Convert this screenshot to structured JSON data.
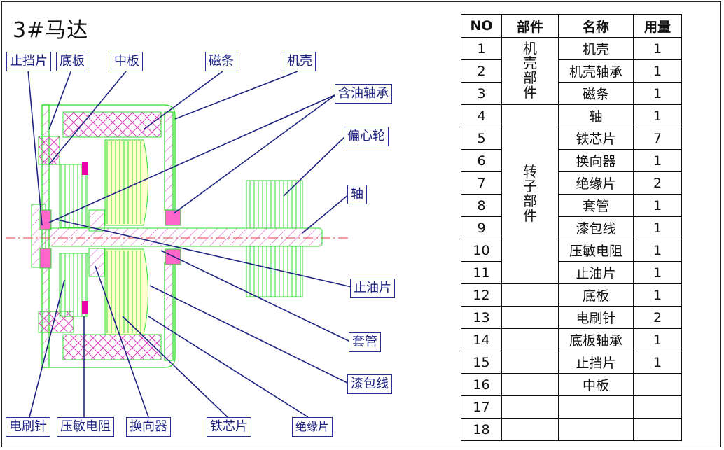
{
  "title": "3#马达",
  "callouts": {
    "stop_plate": "止挡片",
    "base_plate": "底板",
    "mid_plate": "中板",
    "magnet": "磁条",
    "housing": "机壳",
    "oil_bearing": "含油轴承",
    "eccentric": "偏心轮",
    "shaft": "轴",
    "oil_stop": "止油片",
    "sleeve": "套管",
    "enamel_wire": "漆包线",
    "brush": "电刷针",
    "varistor": "压敏电阻",
    "commutator": "换向器",
    "core": "铁芯片",
    "insulation": "绝缘片"
  },
  "table": {
    "headers": [
      "NO",
      "部件",
      "名称",
      "用量"
    ],
    "groups": {
      "housing_group": "机壳部件",
      "rotor_group": "转子部件"
    },
    "rows": [
      {
        "no": "1",
        "name": "机壳",
        "qty": "1"
      },
      {
        "no": "2",
        "name": "机壳轴承",
        "qty": "1"
      },
      {
        "no": "3",
        "name": "磁条",
        "qty": "1"
      },
      {
        "no": "4",
        "name": "轴",
        "qty": "1"
      },
      {
        "no": "5",
        "name": "铁芯片",
        "qty": "7"
      },
      {
        "no": "6",
        "name": "换向器",
        "qty": "1"
      },
      {
        "no": "7",
        "name": "绝缘片",
        "qty": "2"
      },
      {
        "no": "8",
        "name": "套管",
        "qty": "1"
      },
      {
        "no": "9",
        "name": "漆包线",
        "qty": "1"
      },
      {
        "no": "10",
        "name": "压敏电阻",
        "qty": "1"
      },
      {
        "no": "11",
        "name": "止油片",
        "qty": "1"
      },
      {
        "no": "12",
        "name": "底板",
        "qty": "1"
      },
      {
        "no": "13",
        "name": "电刷针",
        "qty": "2"
      },
      {
        "no": "14",
        "name": "底板轴承",
        "qty": "1"
      },
      {
        "no": "15",
        "name": "止挡片",
        "qty": "1"
      },
      {
        "no": "16",
        "name": "中板",
        "qty": ""
      },
      {
        "no": "17",
        "name": "",
        "qty": ""
      },
      {
        "no": "18",
        "name": "",
        "qty": ""
      }
    ]
  },
  "colors": {
    "outline": "#33dd33",
    "hatch": "#e040c0",
    "core_fill": "#ffff99",
    "accent": "#ee00aa",
    "leader": "#1f2480",
    "axis": "#e04040"
  }
}
